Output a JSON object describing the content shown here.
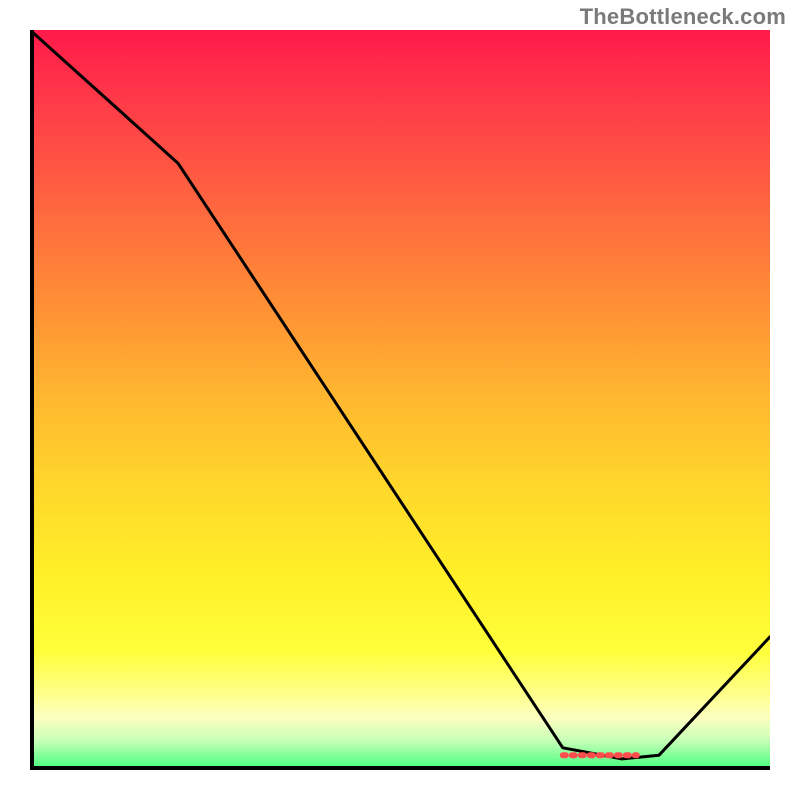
{
  "watermark": "TheBottleneck.com",
  "chart_data": {
    "type": "line",
    "title": "",
    "xlabel": "",
    "ylabel": "",
    "xlim": [
      0,
      100
    ],
    "ylim": [
      0,
      100
    ],
    "curve": [
      {
        "x": 0,
        "y": 100
      },
      {
        "x": 20,
        "y": 82
      },
      {
        "x": 72,
        "y": 3
      },
      {
        "x": 80,
        "y": 1.5
      },
      {
        "x": 85,
        "y": 2
      },
      {
        "x": 100,
        "y": 18
      }
    ],
    "marker": {
      "x_start": 72,
      "x_end": 82,
      "y": 2.0,
      "color": "#ff4d4d",
      "style": "dotted"
    },
    "gradient_stops": [
      {
        "pct": 0,
        "color": "#ff1a4b"
      },
      {
        "pct": 10,
        "color": "#ff3b48"
      },
      {
        "pct": 25,
        "color": "#ff6a3e"
      },
      {
        "pct": 38,
        "color": "#ff9235"
      },
      {
        "pct": 50,
        "color": "#ffb82f"
      },
      {
        "pct": 62,
        "color": "#ffd82b"
      },
      {
        "pct": 74,
        "color": "#fff028"
      },
      {
        "pct": 84,
        "color": "#ffff3a"
      },
      {
        "pct": 90,
        "color": "#ffff8f"
      },
      {
        "pct": 93,
        "color": "#fbffc0"
      },
      {
        "pct": 96,
        "color": "#c8ffb8"
      },
      {
        "pct": 100,
        "color": "#3fff7a"
      }
    ]
  }
}
